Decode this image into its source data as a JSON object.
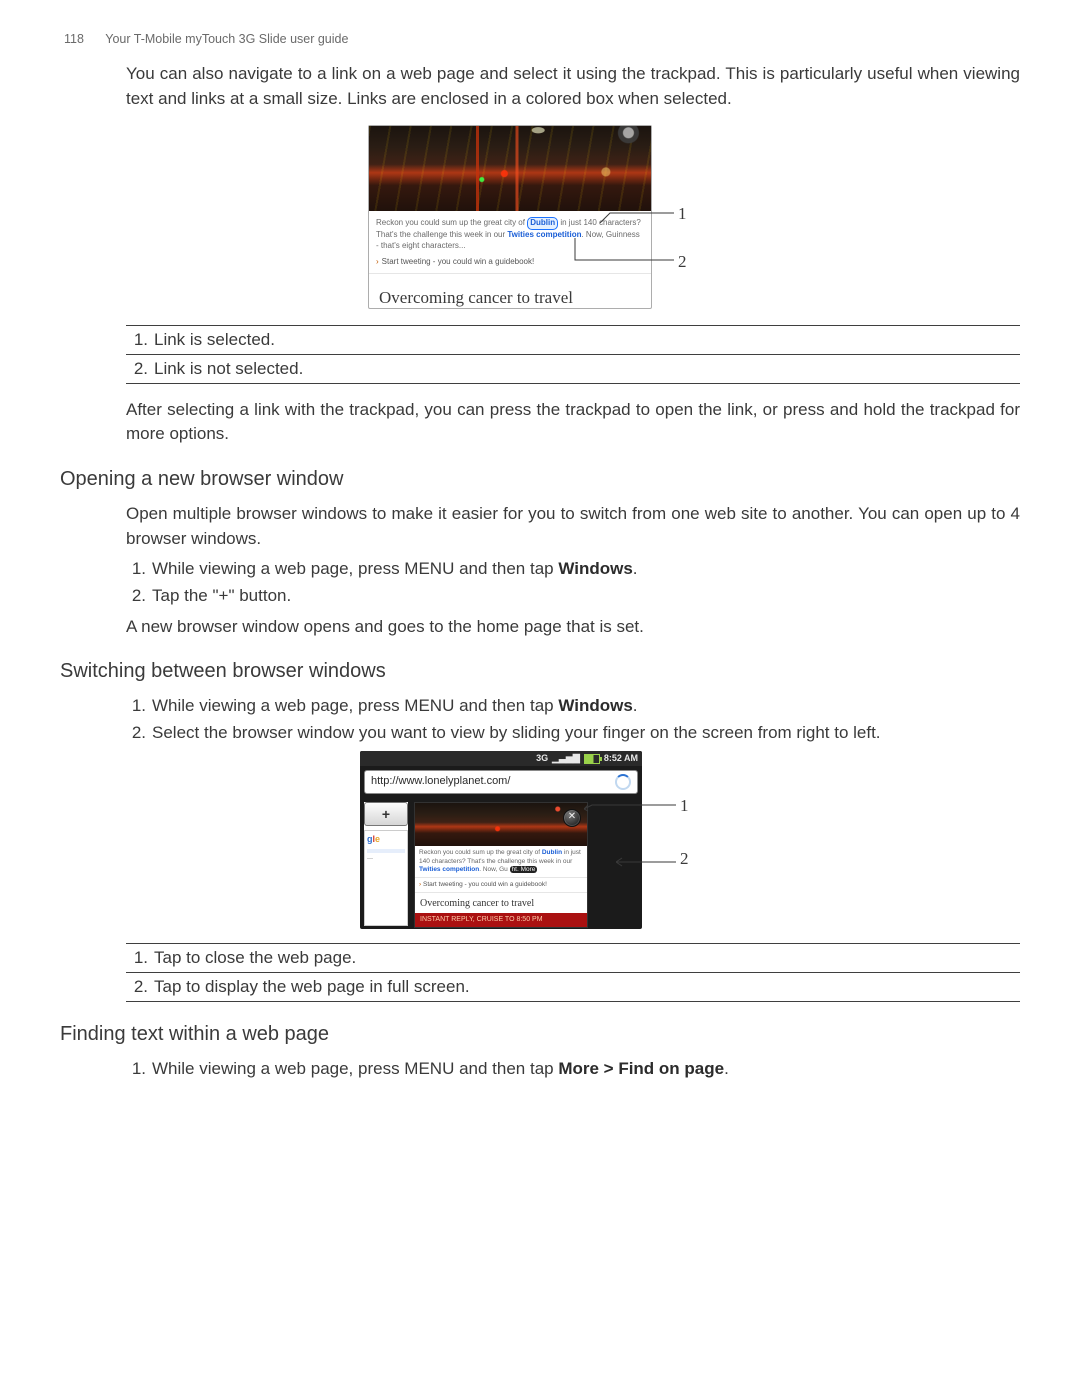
{
  "header": {
    "page_number": "118",
    "title": "Your T-Mobile myTouch 3G Slide user guide"
  },
  "intro": "You can also navigate to a link on a web page and select it using the trackpad. This is particularly useful when viewing text and links at a small size. Links are enclosed in a colored box when selected.",
  "fig1": {
    "snippet_pre": "Reckon you could sum up the great city of ",
    "highlight_boxed": "Dublin",
    "snippet_mid": " in just 140 characters? That's the challenge this week in our ",
    "highlight_link": "Twities competition",
    "snippet_post": ". Now, Guinness - that's eight characters...",
    "subline": "Start tweeting - you could win a guidebook!",
    "headline": "Overcoming cancer to travel",
    "callout_1": "1",
    "callout_2": "2"
  },
  "captions_a": [
    {
      "n": "1.",
      "t": "Link is selected."
    },
    {
      "n": "2.",
      "t": "Link is not selected."
    }
  ],
  "after_fig1": "After selecting a link with the trackpad, you can press the trackpad to open the link, or press and hold the trackpad for more options.",
  "sec1": {
    "title": "Opening a new browser window",
    "intro": "Open multiple browser windows to make it easier for you to switch from one web site to another. You can open up to 4 browser windows.",
    "steps": [
      {
        "n": "1.",
        "pre": "While viewing a web page, press MENU and then tap ",
        "bold": "Windows",
        "post": "."
      },
      {
        "n": "2.",
        "pre": "Tap the \"+\" button.",
        "bold": "",
        "post": ""
      }
    ],
    "outro": "A new browser window opens and goes to the home page that is set."
  },
  "sec2": {
    "title": "Switching between browser windows",
    "steps": [
      {
        "n": "1.",
        "pre": "While viewing a web page, press MENU and then tap ",
        "bold": "Windows",
        "post": "."
      },
      {
        "n": "2.",
        "pre": "Select the browser window you want to view by sliding your finger on the screen from right to left.",
        "bold": "",
        "post": ""
      }
    ]
  },
  "fig2": {
    "status_signal": "3G",
    "status_time": "8:52 AM",
    "url": "http://www.lonelyplanet.com/",
    "plus": "+",
    "close": "✕",
    "snippet_pre": "Reckon you could sum up the great city of ",
    "highlight_boxed": "Dublin",
    "snippet_mid": " in just 140 characters? That's the challenge this week in our ",
    "highlight_link": "Twities competition",
    "snippet_post_a": ". Now, Gu",
    "snippet_post_b": "ht. More",
    "subline": "Start tweeting - you could win a guidebook!",
    "headline": "Overcoming cancer to travel",
    "footer": "INSTANT REPLY, CRUISE TO 8:50 PM",
    "callout_1": "1",
    "callout_2": "2"
  },
  "captions_b": [
    {
      "n": "1.",
      "t": "Tap to close the web page."
    },
    {
      "n": "2.",
      "t": "Tap to display the web page in full screen."
    }
  ],
  "sec3": {
    "title": "Finding text within a web page",
    "steps": [
      {
        "n": "1.",
        "pre": "While viewing a web page, press MENU and then tap ",
        "bold": "More > Find on page",
        "post": "."
      }
    ]
  }
}
